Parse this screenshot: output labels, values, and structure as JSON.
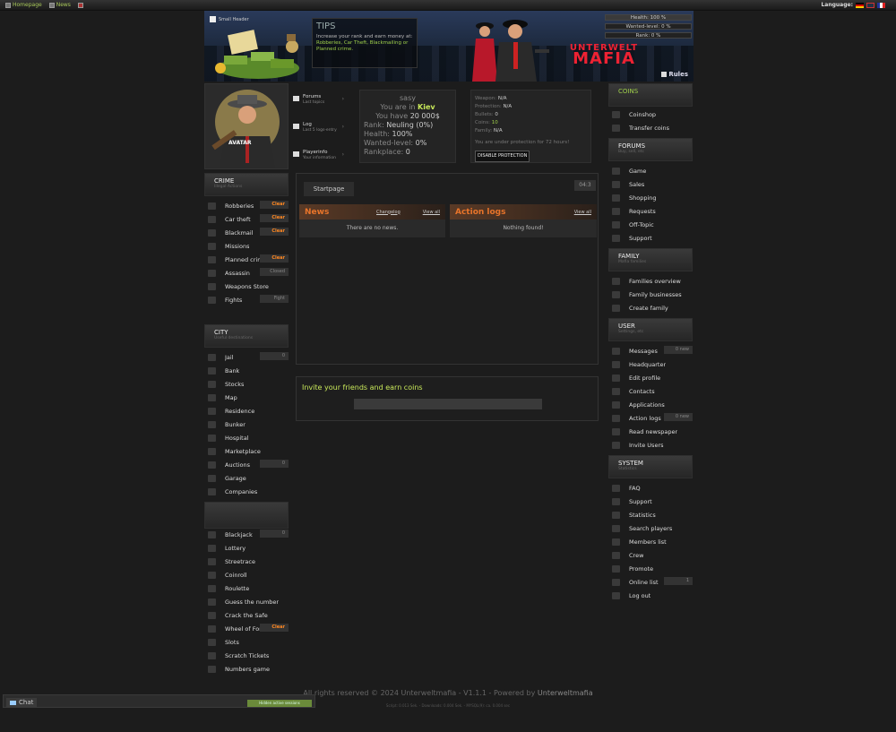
{
  "topbar": {
    "links": [
      "Homepage",
      "News",
      ""
    ],
    "language_label": "Language:"
  },
  "header": {
    "small_header_label": "Small Header",
    "tips_title": "TIPS",
    "tips_text": "Increase your rank and earn money at:",
    "tips_links": "Robberies, Car Theft, Blackmailing or Planned crime.",
    "logo_line1": "UNTERWELT",
    "logo_line2": "MAFIA",
    "rules_label": "Rules",
    "bars": [
      {
        "label": "Health: 100 %",
        "value": 100
      },
      {
        "label": "Wanted-level: 0 %",
        "value": 0
      },
      {
        "label": "Rank: 0 %",
        "value": 0
      }
    ]
  },
  "avatar": {
    "label": "AVATAR"
  },
  "quicklinks": [
    {
      "title": "Forums",
      "sub": "Last topics"
    },
    {
      "title": "Log",
      "sub": "Last 5 logs-entry"
    },
    {
      "title": "Playerinfo",
      "sub": "Your information"
    }
  ],
  "player": {
    "name": "sasy",
    "location_prefix": "You are in",
    "location": "Kiev",
    "money_prefix": "You have",
    "money": "20 000$",
    "rank_label": "Rank:",
    "rank": "Neuling (0%)",
    "health_label": "Health:",
    "health": "100%",
    "wanted_label": "Wanted-level:",
    "wanted": "0%",
    "rankplace_label": "Rankplace:",
    "rankplace": "0"
  },
  "protection": {
    "weapon_label": "Weapon:",
    "weapon": "N/A",
    "protection_label": "Protection:",
    "protection": "N/A",
    "bullets_label": "Bullets:",
    "bullets": "0",
    "coins_label": "Coins:",
    "coins": "10",
    "family_label": "Family:",
    "family": "N/A",
    "notice": "You are under protection for 72 hours!",
    "button": "DISABLE PROTECTION"
  },
  "left": {
    "crime": {
      "title": "CRIME",
      "sub": "Illegal Actions",
      "items": [
        {
          "label": "Robberies",
          "badge": "Clear"
        },
        {
          "label": "Car theft",
          "badge": "Clear"
        },
        {
          "label": "Blackmail",
          "badge": "Clear"
        },
        {
          "label": "Missions",
          "badge": ""
        },
        {
          "label": "Planned crime",
          "badge": "Clear"
        },
        {
          "label": "Assassin",
          "badge": "Closed"
        },
        {
          "label": "Weapons Store",
          "badge": ""
        },
        {
          "label": "Fights",
          "badge": "Fight"
        }
      ]
    },
    "city": {
      "title": "CITY",
      "sub": "Useful destinations",
      "items": [
        {
          "label": "Jail",
          "badge": "0"
        },
        {
          "label": "Bank",
          "badge": ""
        },
        {
          "label": "Stocks",
          "badge": ""
        },
        {
          "label": "Map",
          "badge": ""
        },
        {
          "label": "Residence",
          "badge": ""
        },
        {
          "label": "Bunker",
          "badge": ""
        },
        {
          "label": "Hospital",
          "badge": ""
        },
        {
          "label": "Marketplace",
          "badge": ""
        },
        {
          "label": "Auctions",
          "badge": "0"
        },
        {
          "label": "Garage",
          "badge": ""
        },
        {
          "label": "Companies",
          "badge": ""
        }
      ]
    },
    "casino": {
      "items": [
        {
          "label": "Blackjack",
          "badge": "0"
        },
        {
          "label": "Lottery",
          "badge": ""
        },
        {
          "label": "Streetrace",
          "badge": ""
        },
        {
          "label": "Coinroll",
          "badge": ""
        },
        {
          "label": "Roulette",
          "badge": ""
        },
        {
          "label": "Guess the number",
          "badge": ""
        },
        {
          "label": "Crack the Safe",
          "badge": ""
        },
        {
          "label": "Wheel of Fortune",
          "badge": "Clear"
        },
        {
          "label": "Slots",
          "badge": ""
        },
        {
          "label": "Scratch Tickets",
          "badge": ""
        },
        {
          "label": "Numbers game",
          "badge": ""
        }
      ]
    }
  },
  "right": {
    "coins": {
      "title": "COINS",
      "items": [
        "Coinshop",
        "Transfer coins"
      ]
    },
    "forums": {
      "title": "FORUMS",
      "sub": "Buy, sell, etc",
      "items": [
        "Game",
        "Sales",
        "Shopping",
        "Requests",
        "Off-Topic",
        "Support"
      ]
    },
    "family": {
      "title": "FAMILY",
      "sub": "Mafia families",
      "items": [
        "Families overview",
        "Family businesses",
        "Create family"
      ]
    },
    "user": {
      "title": "USER",
      "sub": "Settings, etc",
      "items": [
        {
          "label": "Messages",
          "badge": "0 new"
        },
        {
          "label": "Headquarter",
          "badge": ""
        },
        {
          "label": "Edit profile",
          "badge": ""
        },
        {
          "label": "Contacts",
          "badge": ""
        },
        {
          "label": "Applications",
          "badge": ""
        },
        {
          "label": "Action logs",
          "badge": "0 new"
        },
        {
          "label": "Read newspaper",
          "badge": ""
        },
        {
          "label": "Invite Users",
          "badge": ""
        }
      ]
    },
    "system": {
      "title": "SYSTEM",
      "sub": "Statistics",
      "items": [
        {
          "label": "FAQ",
          "badge": ""
        },
        {
          "label": "Support",
          "badge": ""
        },
        {
          "label": "Statistics",
          "badge": ""
        },
        {
          "label": "Search players",
          "badge": ""
        },
        {
          "label": "Members list",
          "badge": ""
        },
        {
          "label": "Crew",
          "badge": ""
        },
        {
          "label": "Promote",
          "badge": ""
        },
        {
          "label": "Online list",
          "badge": "1"
        },
        {
          "label": "Log out",
          "badge": ""
        }
      ]
    }
  },
  "main": {
    "tab": "Startpage",
    "timer": "04:3",
    "news": {
      "title": "News",
      "changelog": "Changelog",
      "viewall": "View all",
      "empty": "There are no news."
    },
    "actionlogs": {
      "title": "Action logs",
      "viewall": "View all",
      "empty": "Nothing found!"
    },
    "invite_title": "Invite your friends and earn coins"
  },
  "footer": {
    "text": "All rights reserved © 2024 Unterweltmafia - V1.1.1 - Powered by",
    "brand": "Unterweltmafia",
    "small": "Script: 0.013 Sek. - Downloads: 0.004 Sek. - MYSQL(9): ca. 0.004 sec"
  },
  "chat": {
    "label": "Chat",
    "status": "Hidden active sessions"
  }
}
